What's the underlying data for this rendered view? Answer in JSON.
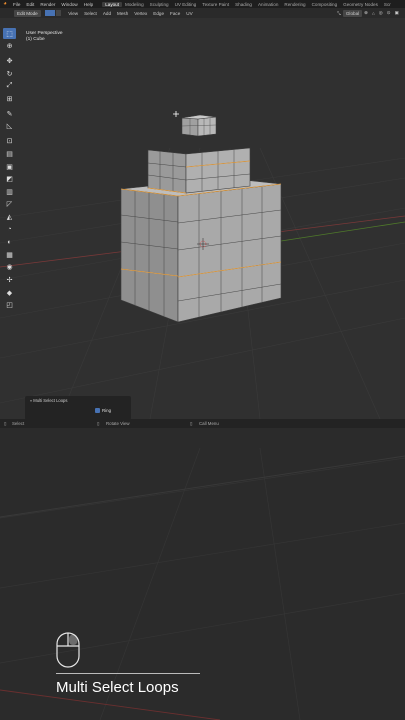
{
  "menubar": {
    "menus": [
      "File",
      "Edit",
      "Render",
      "Window",
      "Help"
    ],
    "workspaces": [
      "Layout",
      "Modeling",
      "Sculpting",
      "UV Editing",
      "Texture Paint",
      "Shading",
      "Animation",
      "Rendering",
      "Compositing",
      "Geometry Nodes",
      "Scr"
    ]
  },
  "header": {
    "mode": "Edit Mode",
    "menus": [
      "View",
      "Select",
      "Add",
      "Mesh",
      "Vertex",
      "Edge",
      "Face",
      "UV"
    ],
    "transform_orientation": "Global"
  },
  "viewport": {
    "view_name": "User Perspective",
    "object_name": "(1) Cube"
  },
  "operator_panel": {
    "title": "Multi Select Loops",
    "ring_label": "Ring",
    "ring_checked": true
  },
  "statusbar": {
    "select": "Select",
    "rotate_view": "Rotate View",
    "call_menu": "Call Menu"
  },
  "caption": {
    "text": "Multi Select Loops"
  },
  "colors": {
    "active_blue": "#4772b3",
    "selected_edge": "#e8a040",
    "grid_x_axis": "#8a3a3a",
    "grid_y_axis": "#5a8a2a"
  },
  "icons": [
    "blender-logo-icon",
    "select-box-icon",
    "cursor-icon",
    "move-icon",
    "rotate-icon",
    "scale-icon",
    "transform-icon",
    "annotate-icon",
    "measure-icon",
    "add-cube-icon",
    "extrude-icon",
    "inset-icon",
    "bevel-icon",
    "loop-cut-icon",
    "knife-icon",
    "poly-build-icon",
    "spin-icon",
    "smooth-icon",
    "edge-slide-icon",
    "shrink-fatten-icon",
    "shear-icon",
    "rip-icon",
    "mouse-icon"
  ]
}
